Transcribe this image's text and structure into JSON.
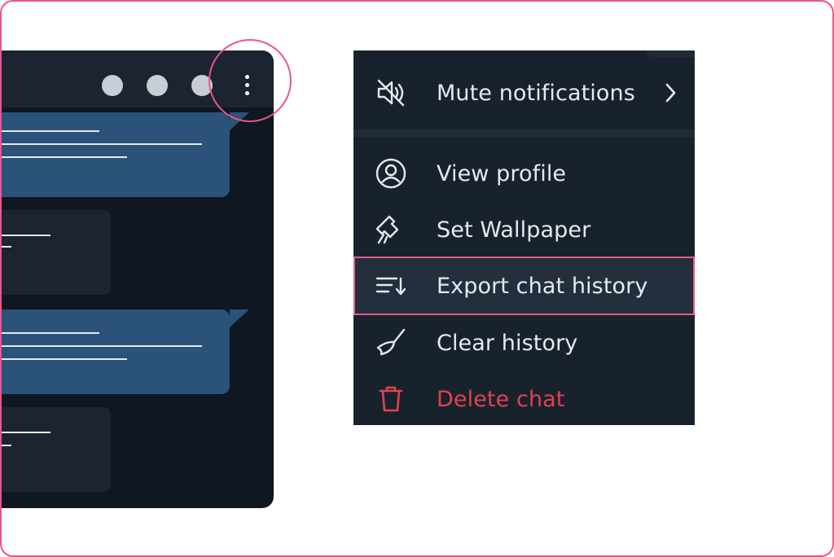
{
  "colors": {
    "accent_highlight": "#e8578a",
    "menu_background": "#18222d",
    "chat_background": "#0f1720",
    "outgoing_bubble": "#2b5278",
    "danger_text": "#e0424f",
    "menu_text": "#e6e9ee"
  },
  "chat_window": {
    "header_icons": [
      "circle-icon",
      "circle-icon",
      "circle-icon",
      "more-vertical-icon"
    ]
  },
  "menu": {
    "items": [
      {
        "icon": "bell-off-icon",
        "label": "Mute notifications",
        "has_submenu": true
      },
      {
        "icon": "user-circle-icon",
        "label": "View profile"
      },
      {
        "icon": "paint-brush-icon",
        "label": "Set Wallpaper"
      },
      {
        "icon": "export-list-icon",
        "label": "Export chat history",
        "highlighted": true
      },
      {
        "icon": "broom-icon",
        "label": "Clear history"
      },
      {
        "icon": "trash-icon",
        "label": "Delete chat",
        "danger": true
      }
    ]
  }
}
